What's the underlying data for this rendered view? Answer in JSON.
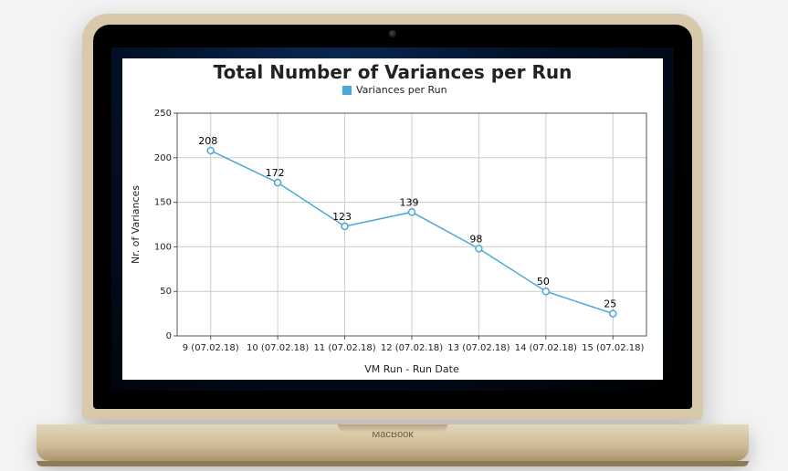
{
  "device": {
    "brand": "MacBook"
  },
  "chart_data": {
    "type": "line",
    "title": "Total Number of Variances per Run",
    "xlabel": "VM Run - Run Date",
    "ylabel": "Nr. of Variances",
    "ylim": [
      0,
      250
    ],
    "ystep": 50,
    "legend_position": "top",
    "grid": true,
    "categories": [
      "9 (07.02.18)",
      "10 (07.02.18)",
      "11 (07.02.18)",
      "12 (07.02.18)",
      "13 (07.02.18)",
      "14 (07.02.18)",
      "15 (07.02.18)"
    ],
    "series": [
      {
        "name": "Variances per Run",
        "values": [
          208,
          172,
          123,
          139,
          98,
          50,
          25
        ]
      }
    ]
  }
}
